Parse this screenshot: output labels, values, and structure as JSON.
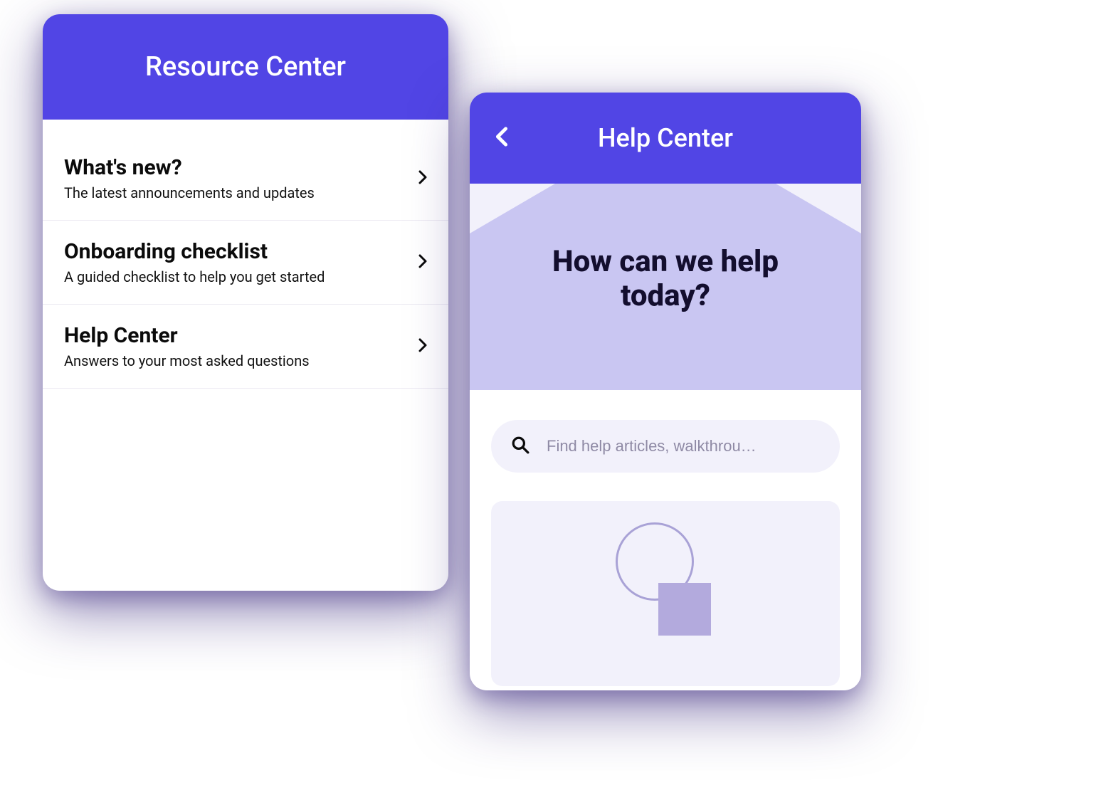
{
  "resource": {
    "title": "Resource Center",
    "items": [
      {
        "title": "What's new?",
        "subtitle": "The latest announcements and updates"
      },
      {
        "title": "Onboarding checklist",
        "subtitle": "A guided checklist to help you get started"
      },
      {
        "title": "Help Center",
        "subtitle": "Answers to your most asked questions"
      }
    ]
  },
  "help": {
    "title": "Help Center",
    "hero_heading": "How can we help today?",
    "search_placeholder": "Find help articles, walkthrou…"
  }
}
